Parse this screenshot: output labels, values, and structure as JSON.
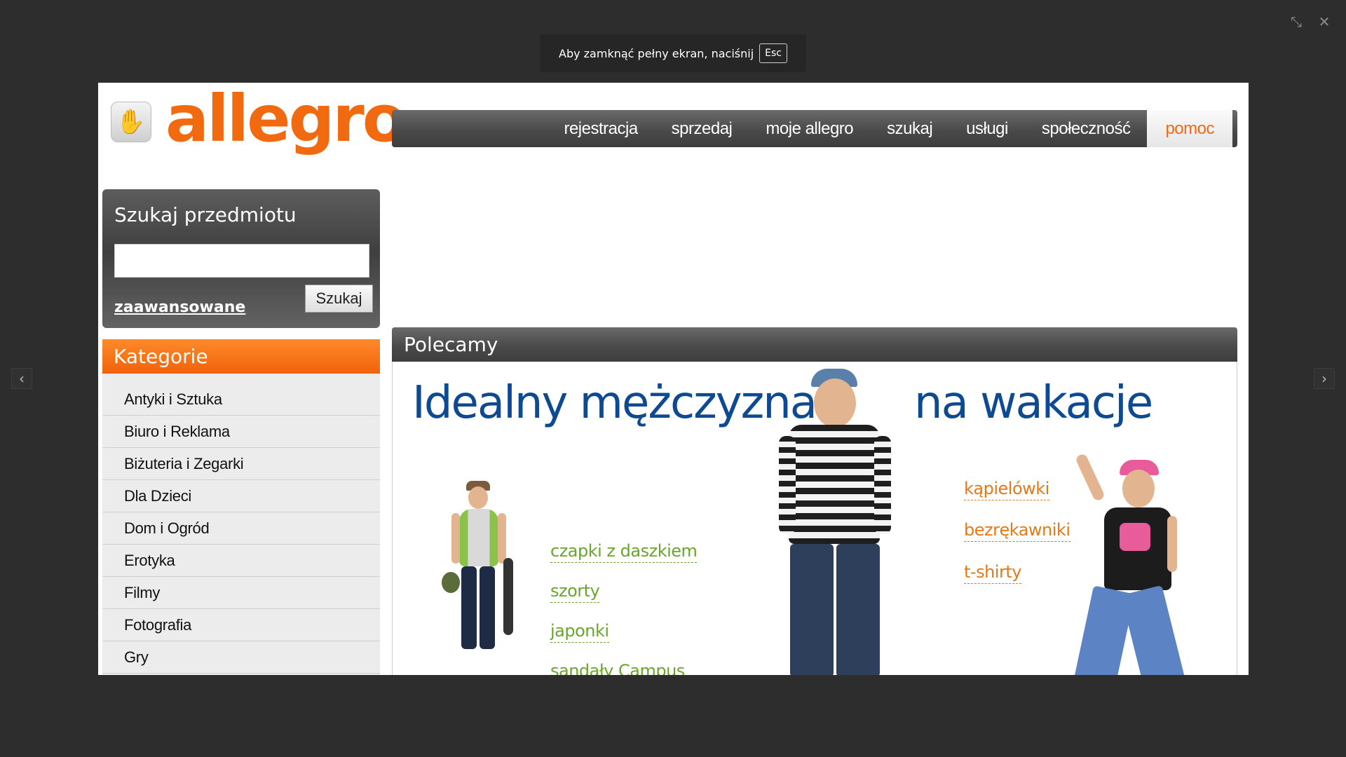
{
  "viewer": {
    "exit_hint": "Aby zamknąć pełny ekran, naciśnij",
    "esc_key": "Esc",
    "icons": [
      "minimize-icon",
      "close-icon",
      "prev-arrow-icon",
      "next-arrow-icon"
    ]
  },
  "logo": {
    "text": "allegro"
  },
  "topnav": {
    "items": [
      "rejestracja",
      "sprzedaj",
      "moje allegro",
      "szukaj",
      "usługi",
      "społeczność",
      "pomoc"
    ],
    "active_index": 6
  },
  "search": {
    "title": "Szukaj przedmiotu",
    "input_value": "",
    "advanced_link": "zaawansowane",
    "button": "Szukaj"
  },
  "categories": {
    "title": "Kategorie",
    "items": [
      "Antyki i Sztuka",
      "Biuro i Reklama",
      "Biżuteria i Zegarki",
      "Dla Dzieci",
      "Dom i Ogród",
      "Erotyka",
      "Filmy",
      "Fotografia",
      "Gry"
    ]
  },
  "recommended": {
    "title": "Polecamy",
    "banner_left": "Idealny mężczyzna",
    "banner_right": "na wakacje",
    "links_left": [
      "czapki z daszkiem",
      "szorty",
      "japonki",
      "sandały Campus"
    ],
    "links_right": [
      "kąpielówki",
      "bezrękawniki",
      "t-shirty"
    ]
  },
  "colors": {
    "brand": "#f26a10",
    "banner_blue": "#0e4a91",
    "link_green": "#6aa52c",
    "link_orange": "#e67916"
  }
}
